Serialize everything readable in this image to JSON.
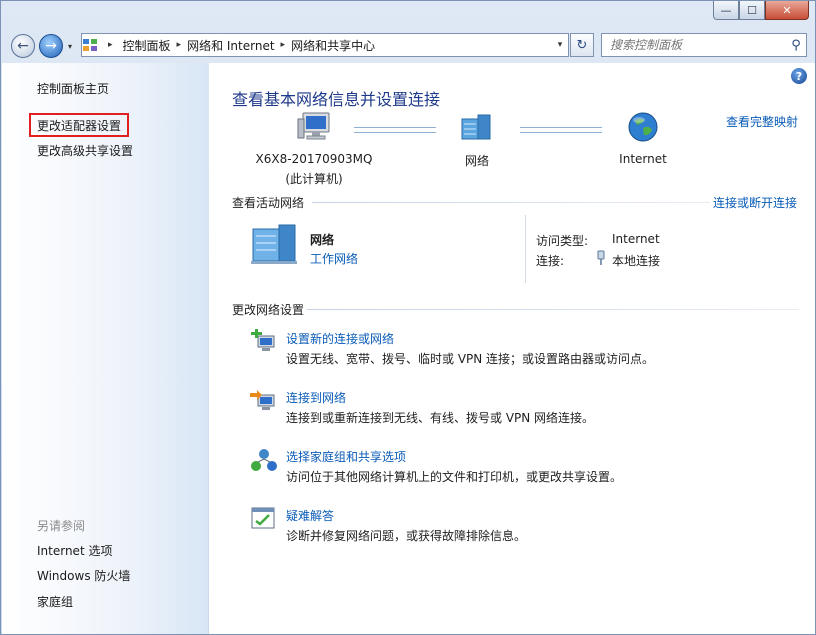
{
  "window": {
    "min_label": "—",
    "max_label": "☐",
    "close_label": "✕"
  },
  "nav": {
    "back_glyph": "←",
    "forward_glyph": "→",
    "history_glyph": "▾",
    "breadcrumbs": [
      "控制面板",
      "网络和 Internet",
      "网络和共享中心"
    ],
    "crumb_separator": "▸",
    "dropdown_glyph": "▾",
    "refresh_glyph": "↻",
    "search_placeholder": "搜索控制面板",
    "search_glyph": "⚲"
  },
  "sidebar": {
    "items": [
      "控制面板主页",
      "更改适配器设置",
      "更改高级共享设置"
    ],
    "highlighted_item": "更改适配器设置",
    "see_also_title": "另请参阅",
    "see_also": [
      "Internet 选项",
      "Windows 防火墙",
      "家庭组"
    ]
  },
  "main": {
    "help_glyph": "?",
    "title": "查看基本网络信息并设置连接",
    "full_map_link": "查看完整映射",
    "map": {
      "computer_name": "X6X8-20170903MQ",
      "computer_sub": "(此计算机)",
      "network_label": "网络",
      "internet_label": "Internet"
    },
    "active_networks": {
      "header": "查看活动网络",
      "connect_link": "连接或断开连接",
      "network_name": "网络",
      "network_type": "工作网络",
      "access_type_label": "访问类型:",
      "access_type_value": "Internet",
      "connections_label": "连接:",
      "connections_value": "本地连接"
    },
    "change_settings": {
      "header": "更改网络设置",
      "tasks": [
        {
          "title": "设置新的连接或网络",
          "desc": "设置无线、宽带、拨号、临时或 VPN 连接；或设置路由器或访问点。",
          "icon": "new-connection-icon"
        },
        {
          "title": "连接到网络",
          "desc": "连接到或重新连接到无线、有线、拨号或 VPN 网络连接。",
          "icon": "connect-network-icon"
        },
        {
          "title": "选择家庭组和共享选项",
          "desc": "访问位于其他网络计算机上的文件和打印机，或更改共享设置。",
          "icon": "homegroup-icon"
        },
        {
          "title": "疑难解答",
          "desc": "诊断并修复网络问题，或获得故障排除信息。",
          "icon": "troubleshoot-icon"
        }
      ]
    }
  },
  "colors": {
    "link": "#0a5cb7",
    "title": "#1e3a8a",
    "highlight_box": "#e02020"
  }
}
